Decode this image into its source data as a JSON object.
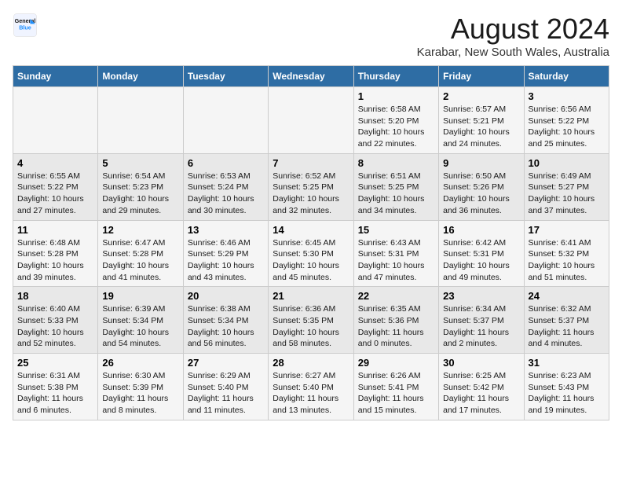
{
  "logo": {
    "line1": "General",
    "line2": "Blue"
  },
  "title": "August 2024",
  "subtitle": "Karabar, New South Wales, Australia",
  "days_header": [
    "Sunday",
    "Monday",
    "Tuesday",
    "Wednesday",
    "Thursday",
    "Friday",
    "Saturday"
  ],
  "weeks": [
    [
      {
        "day": "",
        "info": ""
      },
      {
        "day": "",
        "info": ""
      },
      {
        "day": "",
        "info": ""
      },
      {
        "day": "",
        "info": ""
      },
      {
        "day": "1",
        "info": "Sunrise: 6:58 AM\nSunset: 5:20 PM\nDaylight: 10 hours\nand 22 minutes."
      },
      {
        "day": "2",
        "info": "Sunrise: 6:57 AM\nSunset: 5:21 PM\nDaylight: 10 hours\nand 24 minutes."
      },
      {
        "day": "3",
        "info": "Sunrise: 6:56 AM\nSunset: 5:22 PM\nDaylight: 10 hours\nand 25 minutes."
      }
    ],
    [
      {
        "day": "4",
        "info": "Sunrise: 6:55 AM\nSunset: 5:22 PM\nDaylight: 10 hours\nand 27 minutes."
      },
      {
        "day": "5",
        "info": "Sunrise: 6:54 AM\nSunset: 5:23 PM\nDaylight: 10 hours\nand 29 minutes."
      },
      {
        "day": "6",
        "info": "Sunrise: 6:53 AM\nSunset: 5:24 PM\nDaylight: 10 hours\nand 30 minutes."
      },
      {
        "day": "7",
        "info": "Sunrise: 6:52 AM\nSunset: 5:25 PM\nDaylight: 10 hours\nand 32 minutes."
      },
      {
        "day": "8",
        "info": "Sunrise: 6:51 AM\nSunset: 5:25 PM\nDaylight: 10 hours\nand 34 minutes."
      },
      {
        "day": "9",
        "info": "Sunrise: 6:50 AM\nSunset: 5:26 PM\nDaylight: 10 hours\nand 36 minutes."
      },
      {
        "day": "10",
        "info": "Sunrise: 6:49 AM\nSunset: 5:27 PM\nDaylight: 10 hours\nand 37 minutes."
      }
    ],
    [
      {
        "day": "11",
        "info": "Sunrise: 6:48 AM\nSunset: 5:28 PM\nDaylight: 10 hours\nand 39 minutes."
      },
      {
        "day": "12",
        "info": "Sunrise: 6:47 AM\nSunset: 5:28 PM\nDaylight: 10 hours\nand 41 minutes."
      },
      {
        "day": "13",
        "info": "Sunrise: 6:46 AM\nSunset: 5:29 PM\nDaylight: 10 hours\nand 43 minutes."
      },
      {
        "day": "14",
        "info": "Sunrise: 6:45 AM\nSunset: 5:30 PM\nDaylight: 10 hours\nand 45 minutes."
      },
      {
        "day": "15",
        "info": "Sunrise: 6:43 AM\nSunset: 5:31 PM\nDaylight: 10 hours\nand 47 minutes."
      },
      {
        "day": "16",
        "info": "Sunrise: 6:42 AM\nSunset: 5:31 PM\nDaylight: 10 hours\nand 49 minutes."
      },
      {
        "day": "17",
        "info": "Sunrise: 6:41 AM\nSunset: 5:32 PM\nDaylight: 10 hours\nand 51 minutes."
      }
    ],
    [
      {
        "day": "18",
        "info": "Sunrise: 6:40 AM\nSunset: 5:33 PM\nDaylight: 10 hours\nand 52 minutes."
      },
      {
        "day": "19",
        "info": "Sunrise: 6:39 AM\nSunset: 5:34 PM\nDaylight: 10 hours\nand 54 minutes."
      },
      {
        "day": "20",
        "info": "Sunrise: 6:38 AM\nSunset: 5:34 PM\nDaylight: 10 hours\nand 56 minutes."
      },
      {
        "day": "21",
        "info": "Sunrise: 6:36 AM\nSunset: 5:35 PM\nDaylight: 10 hours\nand 58 minutes."
      },
      {
        "day": "22",
        "info": "Sunrise: 6:35 AM\nSunset: 5:36 PM\nDaylight: 11 hours\nand 0 minutes."
      },
      {
        "day": "23",
        "info": "Sunrise: 6:34 AM\nSunset: 5:37 PM\nDaylight: 11 hours\nand 2 minutes."
      },
      {
        "day": "24",
        "info": "Sunrise: 6:32 AM\nSunset: 5:37 PM\nDaylight: 11 hours\nand 4 minutes."
      }
    ],
    [
      {
        "day": "25",
        "info": "Sunrise: 6:31 AM\nSunset: 5:38 PM\nDaylight: 11 hours\nand 6 minutes."
      },
      {
        "day": "26",
        "info": "Sunrise: 6:30 AM\nSunset: 5:39 PM\nDaylight: 11 hours\nand 8 minutes."
      },
      {
        "day": "27",
        "info": "Sunrise: 6:29 AM\nSunset: 5:40 PM\nDaylight: 11 hours\nand 11 minutes."
      },
      {
        "day": "28",
        "info": "Sunrise: 6:27 AM\nSunset: 5:40 PM\nDaylight: 11 hours\nand 13 minutes."
      },
      {
        "day": "29",
        "info": "Sunrise: 6:26 AM\nSunset: 5:41 PM\nDaylight: 11 hours\nand 15 minutes."
      },
      {
        "day": "30",
        "info": "Sunrise: 6:25 AM\nSunset: 5:42 PM\nDaylight: 11 hours\nand 17 minutes."
      },
      {
        "day": "31",
        "info": "Sunrise: 6:23 AM\nSunset: 5:43 PM\nDaylight: 11 hours\nand 19 minutes."
      }
    ]
  ]
}
